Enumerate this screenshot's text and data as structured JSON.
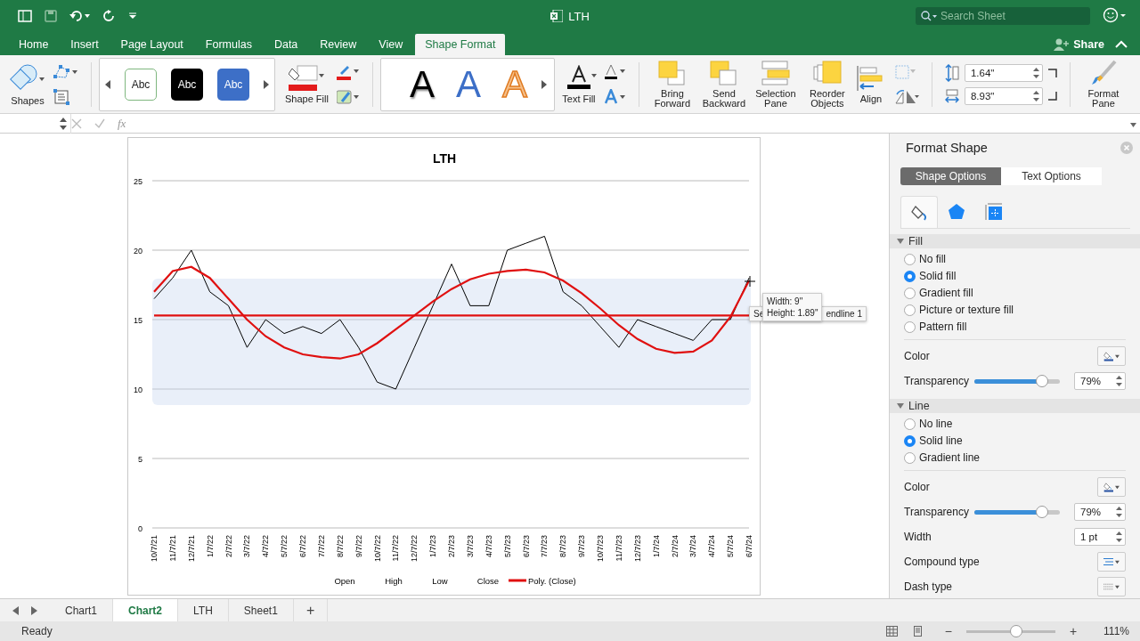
{
  "window": {
    "title": "LTH"
  },
  "search": {
    "placeholder": "Search Sheet"
  },
  "tabs": [
    {
      "label": "Home",
      "selected": false
    },
    {
      "label": "Insert",
      "selected": false
    },
    {
      "label": "Page Layout",
      "selected": false
    },
    {
      "label": "Formulas",
      "selected": false
    },
    {
      "label": "Data",
      "selected": false
    },
    {
      "label": "Review",
      "selected": false
    },
    {
      "label": "View",
      "selected": false
    },
    {
      "label": "Shape Format",
      "selected": true
    }
  ],
  "share": {
    "label": "Share"
  },
  "ribbon": {
    "shapes": {
      "label": "Shapes"
    },
    "shape_styles": [
      {
        "label": "Abc",
        "kind": "outline"
      },
      {
        "label": "Abc",
        "kind": "dark"
      },
      {
        "label": "Abc",
        "kind": "blue"
      }
    ],
    "shape_fill": {
      "label": "Shape Fill"
    },
    "wordart_styles": [
      {
        "label": "A",
        "kind": "black"
      },
      {
        "label": "A",
        "kind": "blue"
      },
      {
        "label": "A",
        "kind": "orange"
      }
    ],
    "text_fill": {
      "label": "Text Fill"
    },
    "arrange": [
      {
        "label": "Bring Forward",
        "kind": "bring"
      },
      {
        "label": "Send Backward",
        "kind": "send"
      },
      {
        "label": "Selection Pane",
        "kind": "pane"
      },
      {
        "label": "Reorder Objects",
        "kind": "reorder"
      },
      {
        "label": "Align",
        "kind": "align"
      }
    ],
    "size": {
      "height": "1.64\"",
      "width": "8.93\""
    },
    "format_pane": {
      "label": "Format Pane"
    }
  },
  "formula_bar": {
    "function_label": "fx"
  },
  "chart": {
    "legend": [
      {
        "label": "Open"
      },
      {
        "label": "High"
      },
      {
        "label": "Low"
      },
      {
        "label": "Close"
      }
    ],
    "size_tooltip": [
      "Width: 9\"",
      "Height: 1.89\""
    ],
    "series_tooltip": [
      "Se",
      "endline 1"
    ],
    "chart_data": {
      "type": "line",
      "title": "LTH",
      "categories": [
        "10/7/21",
        "11/7/21",
        "12/7/21",
        "1/7/22",
        "2/7/22",
        "3/7/22",
        "4/7/22",
        "5/7/22",
        "6/7/22",
        "7/7/22",
        "8/7/22",
        "9/7/22",
        "10/7/22",
        "11/7/22",
        "12/7/22",
        "1/7/23",
        "2/7/23",
        "3/7/23",
        "4/7/23",
        "5/7/23",
        "6/7/23",
        "7/7/23",
        "8/7/23",
        "9/7/23",
        "10/7/23",
        "11/7/23",
        "12/7/23",
        "1/7/24",
        "2/7/24",
        "3/7/24",
        "4/7/24",
        "5/7/24",
        "6/7/24"
      ],
      "series": [
        {
          "color": "#000000",
          "values": [
            16.5,
            18,
            20,
            17,
            16,
            13,
            15,
            14,
            14.5,
            14,
            15,
            13,
            10.5,
            10,
            13,
            16,
            19,
            16,
            16,
            20,
            20.5,
            21,
            17,
            16,
            14.5,
            13,
            15,
            14.5,
            14,
            13.5,
            15,
            15,
            18
          ]
        },
        {
          "name": "Poly. (Close)",
          "color": "#e01010",
          "values": [
            17,
            18.5,
            18.8,
            18,
            16.5,
            15,
            13.8,
            13,
            12.5,
            12.3,
            12.2,
            12.5,
            13.3,
            14.3,
            15.3,
            16.3,
            17.2,
            17.9,
            18.3,
            18.5,
            18.6,
            18.4,
            17.8,
            16.9,
            15.8,
            14.6,
            13.6,
            12.9,
            12.6,
            12.7,
            13.5,
            15.2,
            17.8
          ]
        },
        {
          "color": "#e01010",
          "values": [
            15.3,
            15.3,
            15.3,
            15.3,
            15.3,
            15.3,
            15.3,
            15.3,
            15.3,
            15.3,
            15.3,
            15.3,
            15.3,
            15.3,
            15.3,
            15.3,
            15.3,
            15.3,
            15.3,
            15.3,
            15.3,
            15.3,
            15.3,
            15.3,
            15.3,
            15.3,
            15.3,
            15.3,
            15.3,
            15.3,
            15.3,
            15.3,
            15.3
          ]
        }
      ],
      "ylim": [
        0,
        25
      ],
      "yticks": [
        0,
        5,
        10,
        15,
        20,
        25
      ],
      "grid": true
    }
  },
  "sheet_tabs": [
    {
      "label": "Chart1",
      "selected": false
    },
    {
      "label": "Chart2",
      "selected": true
    },
    {
      "label": "LTH",
      "selected": false
    },
    {
      "label": "Sheet1",
      "selected": false
    }
  ],
  "add_sheet": "+",
  "format_pane": {
    "title": "Format Shape",
    "option_tabs": [
      {
        "label": "Shape Options",
        "selected": true
      },
      {
        "label": "Text Options",
        "selected": false
      }
    ],
    "icon_tabs": [
      {
        "kind": "fill",
        "selected": true
      },
      {
        "kind": "effects",
        "selected": false
      },
      {
        "kind": "size",
        "selected": false
      }
    ],
    "sections": [
      {
        "title": "Fill",
        "expanded": true,
        "options": [
          {
            "label": "No fill",
            "selected": false
          },
          {
            "label": "Solid fill",
            "selected": true
          },
          {
            "label": "Gradient fill",
            "selected": false
          },
          {
            "label": "Picture or texture fill",
            "selected": false
          },
          {
            "label": "Pattern fill",
            "selected": false
          }
        ],
        "rows": [
          {
            "kind": "color",
            "label": "Color"
          },
          {
            "kind": "slider",
            "label": "Transparency",
            "level": 0.79,
            "value": "79%"
          }
        ]
      },
      {
        "title": "Line",
        "expanded": true,
        "options": [
          {
            "label": "No line",
            "selected": false
          },
          {
            "label": "Solid line",
            "selected": true
          },
          {
            "label": "Gradient line",
            "selected": false
          }
        ],
        "rows": [
          {
            "kind": "color",
            "label": "Color"
          },
          {
            "kind": "slider",
            "label": "Transparency",
            "level": 0.79,
            "value": "79%"
          },
          {
            "kind": "spin",
            "label": "Width",
            "value": "1 pt"
          },
          {
            "kind": "compound",
            "label": "Compound type"
          },
          {
            "kind": "dash",
            "label": "Dash type"
          }
        ]
      }
    ]
  },
  "status_bar": {
    "text": "Ready",
    "zoom_out": "−",
    "zoom_in": "+",
    "zoom": {
      "level": 0.56,
      "value": "111%"
    }
  }
}
